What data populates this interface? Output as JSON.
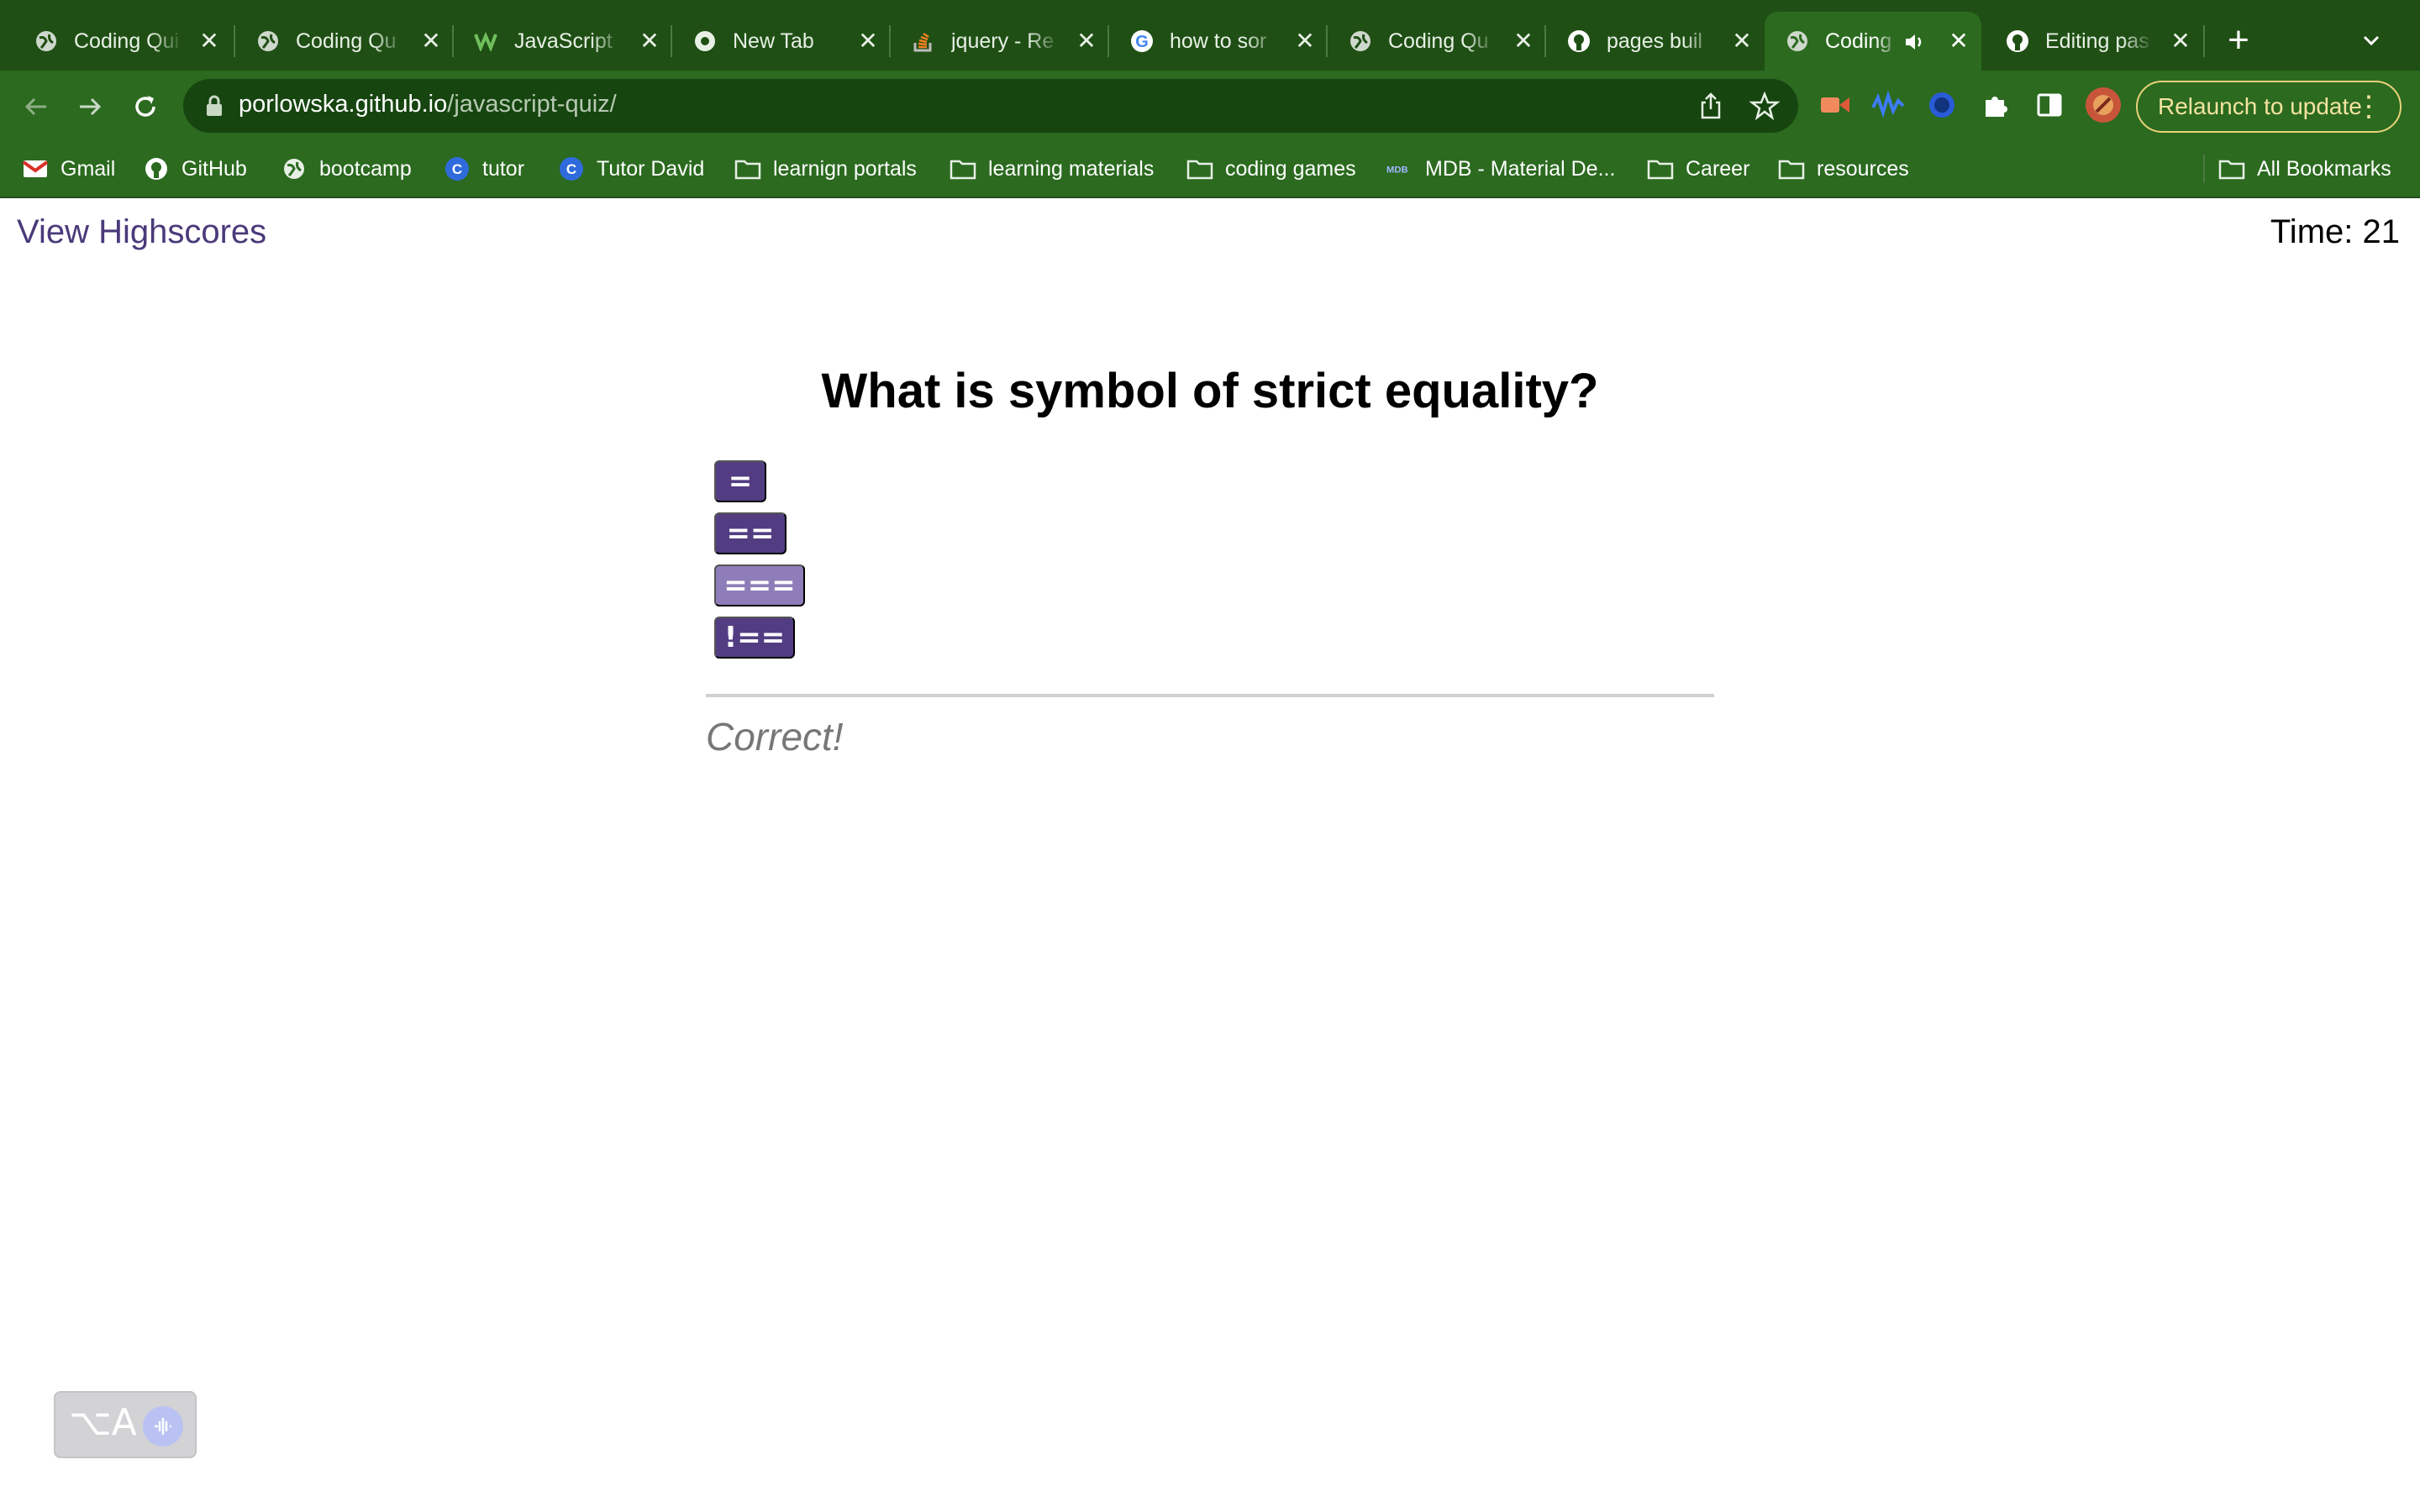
{
  "browser": {
    "tabs": [
      {
        "title": "Coding Qui",
        "icon": "globe-icon",
        "active": false
      },
      {
        "title": "Coding Qu",
        "icon": "globe-icon",
        "active": false
      },
      {
        "title": "JavaScript",
        "icon": "w3schools-icon",
        "active": false
      },
      {
        "title": "New Tab",
        "icon": "chrome-icon",
        "active": false
      },
      {
        "title": "jquery - Re",
        "icon": "stackoverflow-icon",
        "active": false
      },
      {
        "title": "how to sor",
        "icon": "google-icon",
        "active": false
      },
      {
        "title": "Coding Qu",
        "icon": "globe-icon",
        "active": false
      },
      {
        "title": "pages buil",
        "icon": "github-icon",
        "active": false
      },
      {
        "title": "Coding",
        "icon": "globe-icon",
        "active": true,
        "audio": true
      },
      {
        "title": "Editing pas",
        "icon": "github-icon",
        "active": false
      }
    ],
    "url_host": "porlowska.github.io",
    "url_path": "/javascript-quiz/",
    "relaunch_label": "Relaunch to update",
    "bookmarks": [
      {
        "label": "Gmail",
        "icon": "gmail-icon"
      },
      {
        "label": "GitHub",
        "icon": "github-icon"
      },
      {
        "label": "bootcamp",
        "icon": "globe-icon"
      },
      {
        "label": "tutor",
        "icon": "tutor-icon"
      },
      {
        "label": "Tutor David",
        "icon": "tutor-icon"
      },
      {
        "label": "learnign portals",
        "icon": "folder-icon"
      },
      {
        "label": "learning materials",
        "icon": "folder-icon"
      },
      {
        "label": "coding games",
        "icon": "folder-icon"
      },
      {
        "label": "MDB - Material De...",
        "icon": "mdb-icon"
      },
      {
        "label": "Career",
        "icon": "folder-icon"
      },
      {
        "label": "resources",
        "icon": "folder-icon"
      }
    ],
    "all_bookmarks_label": "All Bookmarks"
  },
  "page": {
    "highscores_link": "View Highscores",
    "timer_label": "Time: ",
    "timer_value": "21",
    "question": "What is symbol of strict equality?",
    "answers": [
      "=",
      "==",
      "===",
      "!=="
    ],
    "hovered_answer": "===",
    "feedback": "Correct!",
    "colors": {
      "button": "#533d82",
      "button_hover": "#8e7db8",
      "link": "#4a3a7a"
    }
  },
  "translate_widget": {
    "label": "⌥A"
  }
}
